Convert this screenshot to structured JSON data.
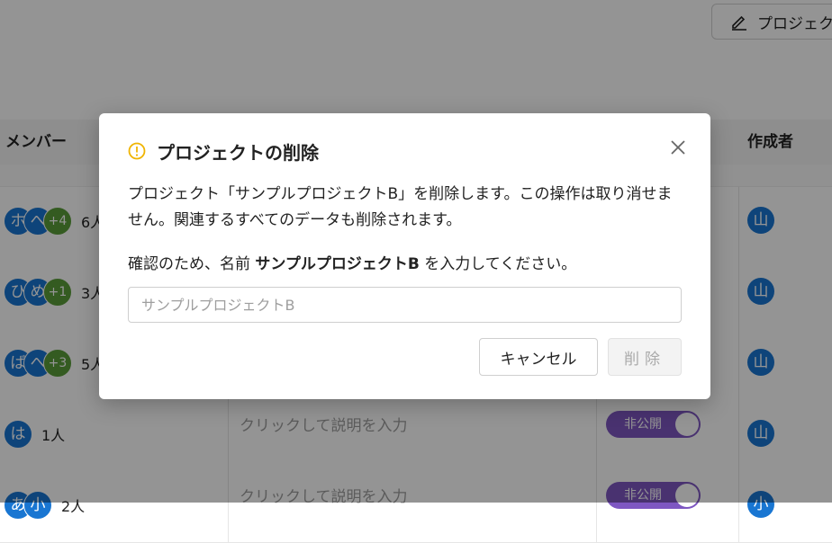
{
  "header": {
    "edit_button_label": "プロジェク"
  },
  "table": {
    "columns": {
      "members": "メンバー",
      "creator": "作成者"
    },
    "rows": [
      {
        "avatars": [
          "ホ",
          "へ"
        ],
        "more": "+4",
        "count": "6人",
        "desc": "",
        "toggle": "",
        "creator": "山"
      },
      {
        "avatars": [
          "ひ",
          "め"
        ],
        "more": "+1",
        "count": "3人",
        "desc": "",
        "toggle": "",
        "creator": "山"
      },
      {
        "avatars": [
          "ば",
          "へ"
        ],
        "more": "+3",
        "count": "5人",
        "desc": "",
        "toggle": "",
        "creator": "山"
      },
      {
        "avatars": [
          "は"
        ],
        "more": "",
        "count": "1人",
        "desc": "クリックして説明を入力",
        "toggle": "非公開",
        "creator": "山"
      },
      {
        "avatars": [
          "あ",
          "小"
        ],
        "more": "",
        "count": "2人",
        "desc": "クリックして説明を入力",
        "toggle": "非公開",
        "creator": "小"
      }
    ]
  },
  "dialog": {
    "title": "プロジェクトの削除",
    "message": "プロジェクト「サンプルプロジェクトB」を削除します。この操作は取り消せません。関連するすべてのデータも削除されます。",
    "confirm_prefix": "確認のため、名前 ",
    "confirm_name": "サンプルプロジェクトB",
    "confirm_suffix": " を入力してください。",
    "input_placeholder": "サンプルプロジェクトB",
    "input_value": "",
    "cancel_label": "キャンセル",
    "delete_label": "削除",
    "icons": {
      "warning": "warning-circle-icon",
      "close": "close-icon",
      "edit": "pencil-icon"
    }
  },
  "colors": {
    "warning": "#f0b400",
    "avatar": "#1976d2",
    "more_badge": "#5a9e3a",
    "toggle": "#7e57c2"
  }
}
